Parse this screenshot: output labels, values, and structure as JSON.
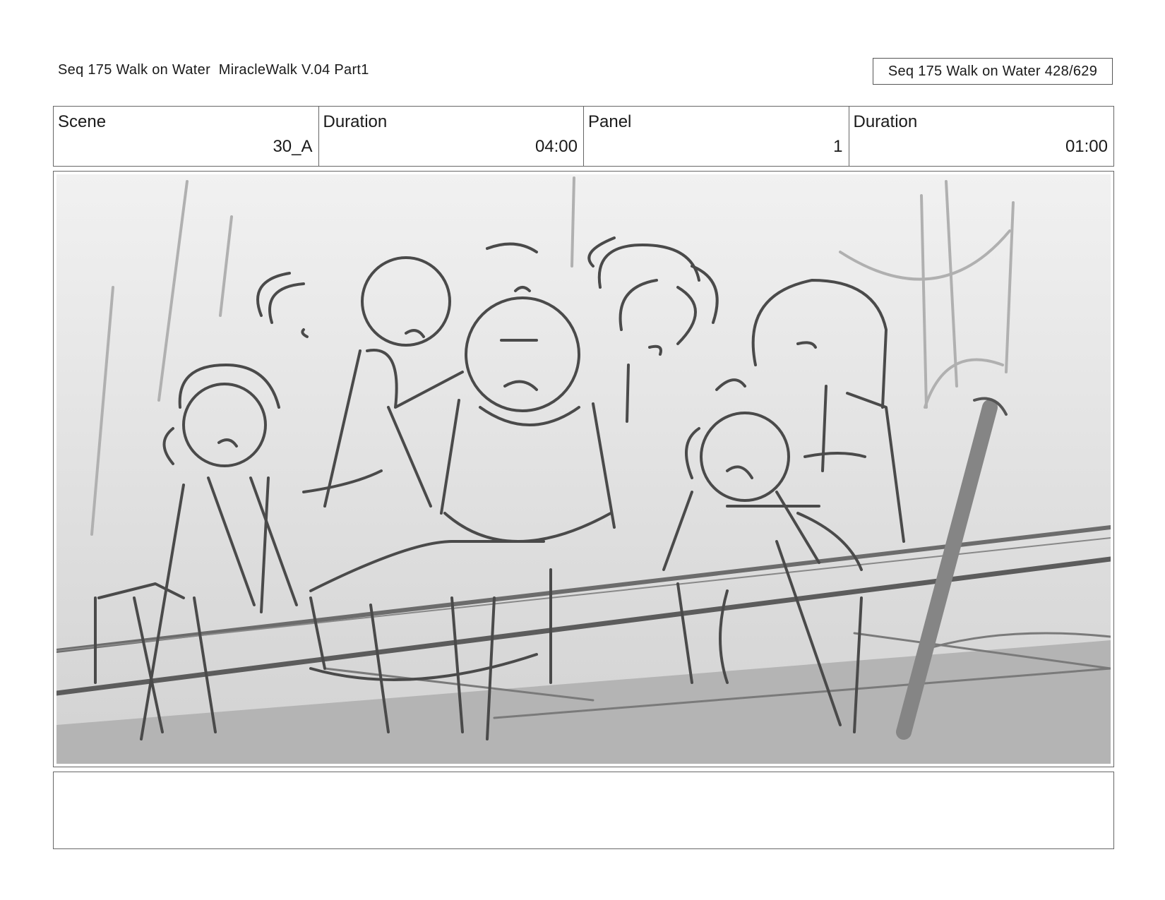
{
  "header": {
    "title": "Seq 175 Walk on Water  MiracleWalk V.04 Part1",
    "page_counter": "Seq 175 Walk on Water 428/629"
  },
  "info": {
    "scene_label": "Scene",
    "scene_value": "30_A",
    "scene_duration_label": "Duration",
    "scene_duration_value": "04:00",
    "panel_label": "Panel",
    "panel_value": "1",
    "panel_duration_label": "Duration",
    "panel_duration_value": "01:00"
  },
  "notes": {
    "text": ""
  }
}
